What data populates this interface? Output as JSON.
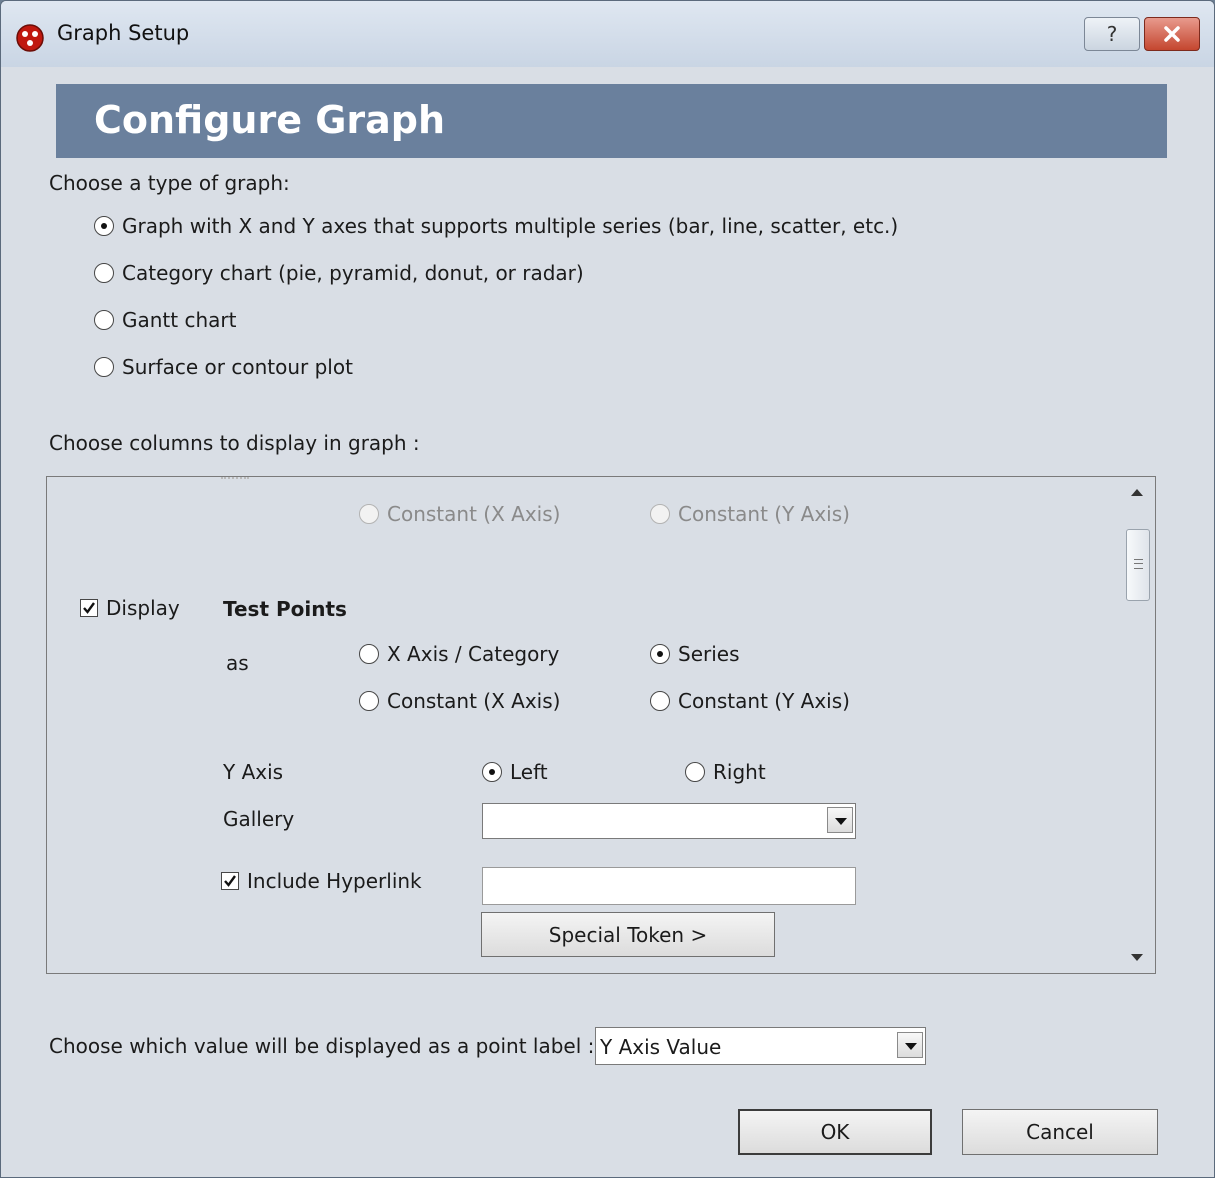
{
  "window": {
    "title": "Graph Setup",
    "help_label": "?"
  },
  "banner": {
    "title": "Configure Graph"
  },
  "graph_type": {
    "prompt": "Choose a type of graph:",
    "options": [
      {
        "label": "Graph with X and Y axes that supports multiple series (bar, line, scatter, etc.)",
        "checked": true
      },
      {
        "label": "Category chart (pie, pyramid, donut, or radar)",
        "checked": false
      },
      {
        "label": "Gantt chart",
        "checked": false
      },
      {
        "label": "Surface or contour plot",
        "checked": false
      }
    ]
  },
  "columns": {
    "prompt": "Choose columns to display in graph :",
    "previous_row": {
      "constant_x_label": "Constant (X Axis)",
      "constant_y_label": "Constant (Y Axis)"
    },
    "row": {
      "display_label": "Display",
      "display_checked": true,
      "name": "Test Points",
      "as_label": "as",
      "x_axis_category_label": "X Axis / Category",
      "series_label": "Series",
      "series_checked": true,
      "constant_x_label": "Constant (X Axis)",
      "constant_y_label": "Constant (Y Axis)",
      "y_axis_label": "Y Axis",
      "left_label": "Left",
      "left_checked": true,
      "right_label": "Right",
      "gallery_label": "Gallery",
      "gallery_value": "",
      "include_hyperlink_label": "Include Hyperlink",
      "include_hyperlink_checked": true,
      "hyperlink_value": "",
      "special_token_label": "Special Token >"
    }
  },
  "point_label": {
    "prompt": "Choose which value will be displayed as a point label :",
    "value": "Y Axis Value"
  },
  "buttons": {
    "ok": "OK",
    "cancel": "Cancel"
  },
  "colors": {
    "banner": "#6a809d",
    "background": "#d9dee5"
  }
}
